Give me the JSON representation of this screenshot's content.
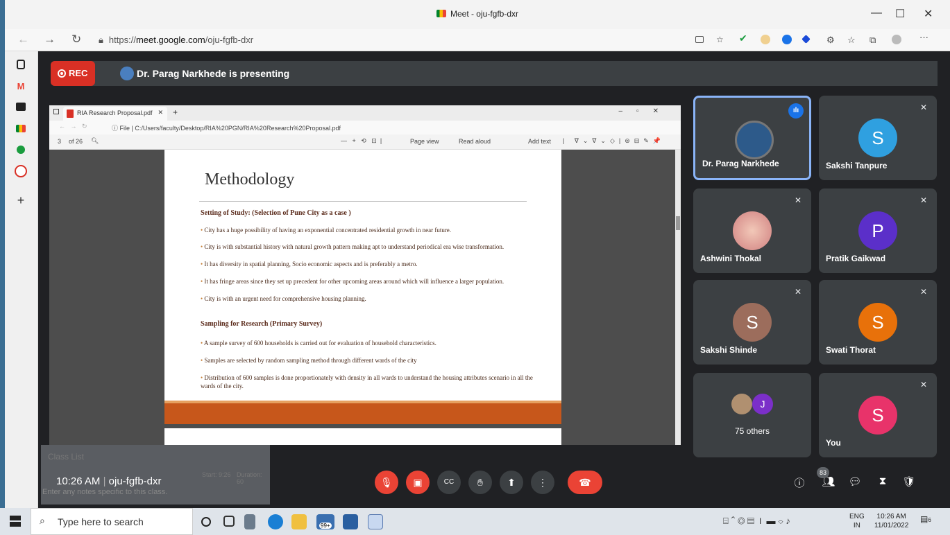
{
  "window": {
    "title": "Meet - oju-fgfb-dxr",
    "minimize": "—",
    "maximize": "☐",
    "close": "✕"
  },
  "browser": {
    "url_prefix": "https://",
    "url_host": "meet.google.com",
    "url_path": "/oju-fgfb-dxr",
    "more": "···"
  },
  "meet": {
    "rec_label": "REC",
    "presenting_text": "Dr. Parag Narkhede is presenting",
    "clock": "10:26 AM",
    "separator": "|",
    "meeting_code": "oju-fgfb-dxr",
    "people_count": "83"
  },
  "shared": {
    "tab_title": "RIA Research Proposal.pdf",
    "file_label": "File",
    "file_path": "C:/Users/faculty/Desktop/RIA%20PGN/RIA%20Research%20Proposal.pdf",
    "page_num": "3",
    "page_total": "of 26",
    "page_view": "Page view",
    "read_aloud": "Read aloud",
    "add_text": "Add text",
    "heading": "Methodology",
    "section1": "Setting of Study: (Selection of Pune City as a case )",
    "bullets1": [
      "City has a huge possibility of having an exponential concentrated residential growth in near future.",
      "City is with substantial history with natural growth pattern making apt to understand periodical era wise transformation.",
      "It has diversity in spatial planning, Socio economic aspects and is preferably a metro.",
      "It has fringe areas since they set up precedent for other upcoming areas around which will influence a larger population.",
      "City is with an urgent need for comprehensive housing planning."
    ],
    "section2": "Sampling for Research (Primary Survey)",
    "bullets2": [
      "A sample survey of 600 households is carried out for evaluation of household characteristics.",
      "Samples are selected by random sampling method through different wards of the city",
      "Distribution of 600 samples is done proportionately with density in all wards to understand  the housing attributes scenario in all the wards of the city."
    ]
  },
  "participants": [
    {
      "name": "Dr. Parag Narkhede",
      "initial": "",
      "color": "#2d5a8a"
    },
    {
      "name": "Sakshi Tanpure",
      "initial": "S",
      "color": "#2fa0e0"
    },
    {
      "name": "Ashwini Thokal",
      "initial": "",
      "color": "#e8b0a0"
    },
    {
      "name": "Pratik Gaikwad",
      "initial": "P",
      "color": "#5b2fc9"
    },
    {
      "name": "Sakshi Shinde",
      "initial": "S",
      "color": "#9c6d5c"
    },
    {
      "name": "Swati Thorat",
      "initial": "S",
      "color": "#e8710a"
    },
    {
      "name": "75 others",
      "initial": "J",
      "color": "#7b2fc9"
    },
    {
      "name": "You",
      "initial": "S",
      "color": "#e8336a"
    }
  ],
  "overlay": {
    "class_list": "Class List",
    "start": "Start: 9:26",
    "duration": "Duration: 60",
    "notes": "Enter any notes specific to this class."
  },
  "taskbar": {
    "search_placeholder": "Type here to search",
    "badge": "99+",
    "lang": "ENG",
    "region": "IN",
    "time": "10:26 AM",
    "date": "11/01/2022",
    "notif": "6"
  },
  "colors": {
    "accent": "#8ab4f8",
    "end_call": "#ea4335",
    "meet_bg": "#202124",
    "tile_bg": "#3c4043"
  }
}
